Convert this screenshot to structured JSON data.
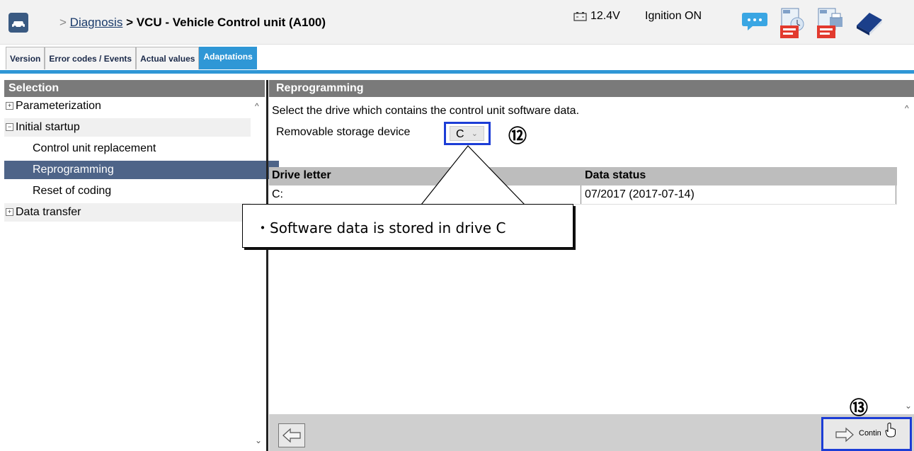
{
  "header": {
    "breadcrumb_sep": ">",
    "breadcrumb_link": "Diagnosis",
    "breadcrumb_title": "> VCU - Vehicle Control unit (A100)",
    "voltage": "12.4V",
    "ignition": "Ignition ON",
    "icons": [
      "car-icon",
      "battery-icon",
      "chat-icon",
      "pdf-history-icon",
      "pdf-print-icon",
      "manual-book-icon"
    ]
  },
  "tabs": [
    {
      "label": "Version",
      "active": false
    },
    {
      "label": "Error codes / Events",
      "active": false
    },
    {
      "label": "Actual values",
      "active": false
    },
    {
      "label": "Adaptations",
      "active": true
    }
  ],
  "selection": {
    "title": "Selection",
    "items": [
      {
        "label": "Parameterization",
        "type": "group",
        "toggle": "+"
      },
      {
        "label": "Initial startup",
        "type": "group",
        "toggle": "−"
      },
      {
        "label": "Control unit replacement",
        "type": "child"
      },
      {
        "label": "Reprogramming",
        "type": "child",
        "selected": true
      },
      {
        "label": "Reset of coding",
        "type": "child"
      },
      {
        "label": "Data transfer",
        "type": "group",
        "toggle": "+"
      }
    ]
  },
  "content": {
    "title": "Reprogramming",
    "instruction": "Select the drive which contains the control unit software data.",
    "storage_label": "Removable storage device",
    "storage_value": "C",
    "table": {
      "headers": [
        "Drive letter",
        "Data status"
      ],
      "rows": [
        [
          "C:",
          "07/2017 (2017-07-14)"
        ]
      ]
    }
  },
  "annotations": {
    "step12": "⑫",
    "step13": "⑬",
    "callout": "・Software data is stored in drive C"
  },
  "footer": {
    "continue_label": "Contin"
  },
  "colors": {
    "tab_active": "#2f97d6",
    "header_bar": "#7a7a7a",
    "selected_item": "#4e6488",
    "highlight_border": "#1c3dd6"
  }
}
